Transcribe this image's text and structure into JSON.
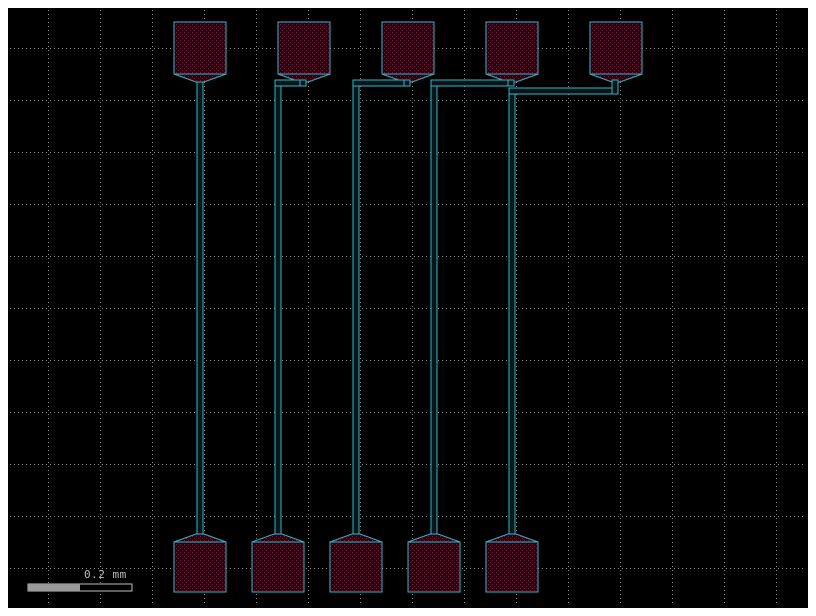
{
  "scale_bar": {
    "label": "0.2 mm",
    "fraction_filled": 0.5
  },
  "colors": {
    "background": "#000000",
    "grid": "#8a8a8a",
    "outline": "#2fb7c6",
    "pad_hatch": "#7a1a3a",
    "scale_fill": "#9a9a9a",
    "scale_label": "#bfbfbf"
  },
  "layout": {
    "top_pad_count": 5,
    "bottom_pad_count": 5,
    "trace_count": 5,
    "grid": "on"
  }
}
